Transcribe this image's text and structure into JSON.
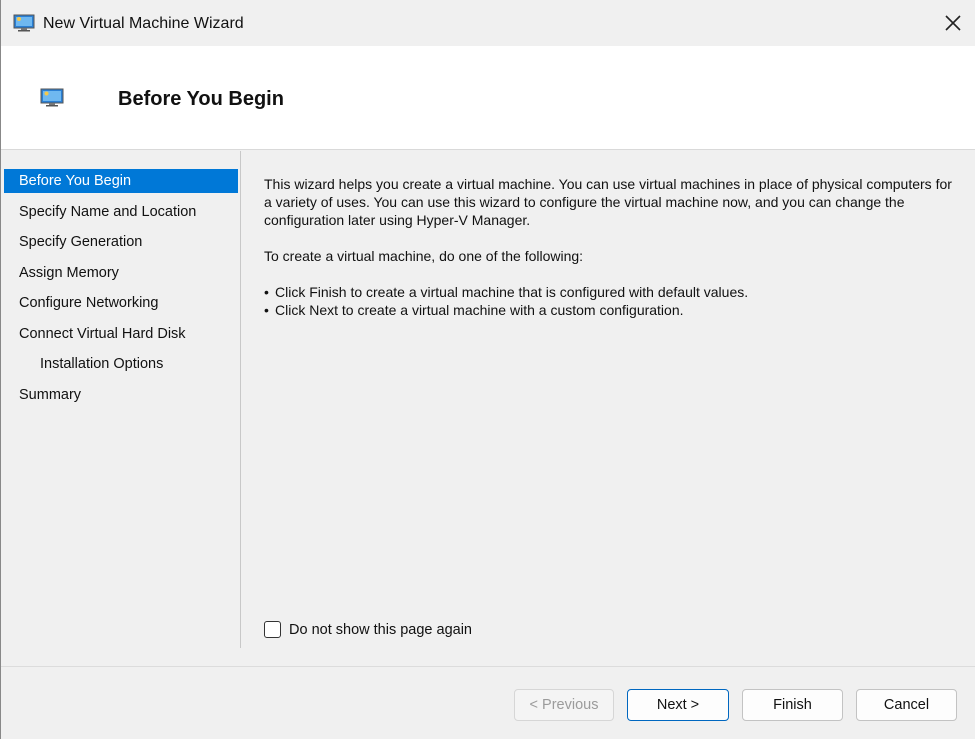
{
  "window": {
    "title": "New Virtual Machine Wizard",
    "close_glyph": "✕"
  },
  "header": {
    "title": "Before You Begin",
    "icon": "monitor-icon"
  },
  "nav": {
    "items": [
      {
        "label": "Before You Begin",
        "active": true
      },
      {
        "label": "Specify Name and Location"
      },
      {
        "label": "Specify Generation"
      },
      {
        "label": "Assign Memory"
      },
      {
        "label": "Configure Networking"
      },
      {
        "label": "Connect Virtual Hard Disk"
      },
      {
        "label": "Installation Options",
        "sub": true
      },
      {
        "label": "Summary"
      }
    ]
  },
  "content": {
    "intro": "This wizard helps you create a virtual machine. You can use virtual machines in place of physical computers for a variety of uses. You can use this wizard to configure the virtual machine now, and you can change the configuration later using Hyper-V Manager.",
    "instructions": "To create a virtual machine, do one of the following:",
    "bullets": [
      "Click Finish to create a virtual machine that is configured with default values.",
      "Click Next to create a virtual machine with a custom configuration."
    ]
  },
  "checkbox": {
    "label": "Do not show this page again",
    "checked": false
  },
  "buttons": {
    "previous": "< Previous",
    "next": "Next >",
    "finish": "Finish",
    "cancel": "Cancel"
  },
  "colors": {
    "accent": "#0078d7"
  }
}
